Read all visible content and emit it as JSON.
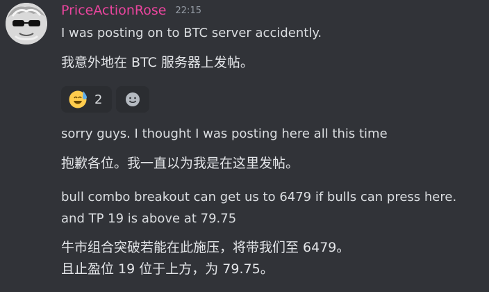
{
  "message": {
    "author": "PriceActionRose",
    "timestamp": "22:15",
    "lines": [
      "I was posting on to BTC server accidently.",
      "我意外地在 BTC 服务器上发帖。",
      "sorry guys. I thought I was posting here all this time",
      "抱歉各位。我一直以为我是在这里发帖。",
      "bull combo breakout can get us to 6479 if bulls can press here.",
      "and TP 19 is above at 79.75",
      "牛市组合突破若能在此施压，将带我们至 6479。",
      "且止盈位 19 位于上方，为 79.75。"
    ]
  },
  "reactions": {
    "items": [
      {
        "emoji": "sweat-smile-icon",
        "count": "2"
      }
    ],
    "add_reaction_icon": "add-reaction-icon"
  },
  "colors": {
    "background": "#313338",
    "author": "#eb459e",
    "text": "#dbdee1",
    "timestamp": "#949ba4",
    "reaction_bg": "#2b2d31"
  }
}
